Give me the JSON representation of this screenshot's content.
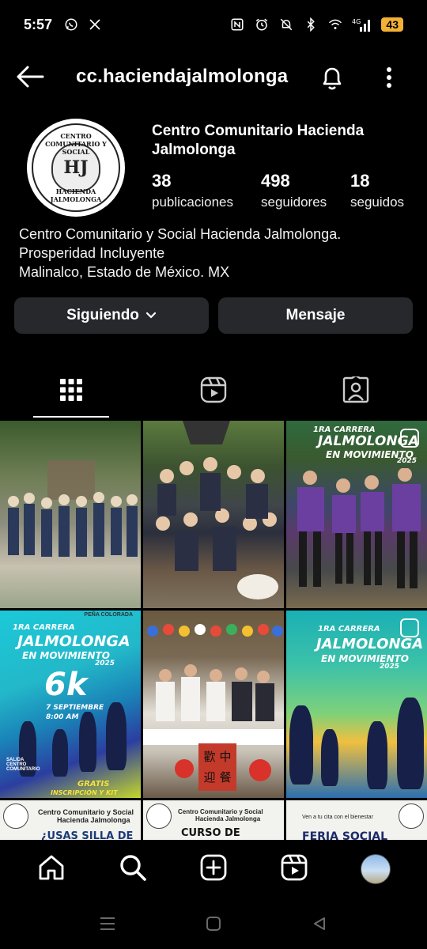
{
  "status_bar": {
    "time": "5:57",
    "battery": "43",
    "network": "4G"
  },
  "header": {
    "username": "cc.haciendajalmolonga",
    "icons": [
      "back-arrow-icon",
      "bell-icon",
      "more-vertical-icon"
    ]
  },
  "profile": {
    "avatar_seal_top": "CENTRO COMUNITARIO Y SOCIAL",
    "avatar_seal_bottom": "HACIENDA JALMOLONGA",
    "avatar_monogram": "HJ",
    "full_name": "Centro Comunitario Hacienda Jalmolonga",
    "stats": [
      {
        "value": "38",
        "label": "publicaciones"
      },
      {
        "value": "498",
        "label": "seguidores"
      },
      {
        "value": "18",
        "label": "seguidos"
      }
    ],
    "bio_lines": [
      "Centro Comunitario y Social Hacienda Jalmolonga.",
      "Prosperidad Incluyente",
      "Malinalco, Estado de México. MX"
    ]
  },
  "actions": {
    "following_label": "Siguiendo",
    "message_label": "Mensaje"
  },
  "tabs": [
    {
      "name": "grid",
      "icon": "grid-icon",
      "active": true
    },
    {
      "name": "reels",
      "icon": "reels-icon",
      "active": false
    },
    {
      "name": "tagged",
      "icon": "tagged-person-icon",
      "active": false
    }
  ],
  "posts": {
    "p3_title_1": "1RA CARRERA",
    "p3_title_2": "JALMOLONGA",
    "p3_title_3": "EN MOVIMIENTO",
    "p3_year": "2025",
    "p4_header": "PEÑA COLORADA",
    "p4_title_1": "1RA CARRERA",
    "p4_title_2": "JALMOLONGA",
    "p4_title_3": "EN MOVIMIENTO",
    "p4_year": "2025",
    "p4_distance": "6k",
    "p4_date": "7 SEPTIEMBRE",
    "p4_time": "8:00 AM",
    "p4_start_1": "SALIDA",
    "p4_start_2": "CENTRO",
    "p4_start_3": "COMUNITARIO",
    "p4_free_1": "GRATIS",
    "p4_free_2": "INSCRIPCIÓN Y KIT",
    "p5_sign_1": "歡",
    "p5_sign_2": "中",
    "p5_sign_3": "迎",
    "p5_sign_4": "餐",
    "p6_title_1": "1RA CARRERA",
    "p6_title_2": "JALMOLONGA",
    "p6_title_3": "EN MOVIMIENTO",
    "p6_year": "2025",
    "p7_org_1": "Centro Comunitario y Social",
    "p7_org_2": "Hacienda Jalmolonga",
    "p7_headline": "¿USAS SILLA DE",
    "p8_org_1": "Centro Comunitario y Social",
    "p8_org_2": "Hacienda Jalmolonga",
    "p8_headline": "CURSO DE",
    "p9_tagline": "Ven a tu cita con el bienestar",
    "p9_headline": "FERIA SOCIAL"
  },
  "bottom_nav": [
    {
      "name": "home",
      "icon": "home-icon"
    },
    {
      "name": "search",
      "icon": "search-icon"
    },
    {
      "name": "create",
      "icon": "create-plus-icon"
    },
    {
      "name": "reels",
      "icon": "reels-icon"
    },
    {
      "name": "profile",
      "icon": "profile-avatar-icon"
    }
  ],
  "system_nav": [
    "recents-icon",
    "home-circle-icon",
    "back-triangle-icon"
  ]
}
